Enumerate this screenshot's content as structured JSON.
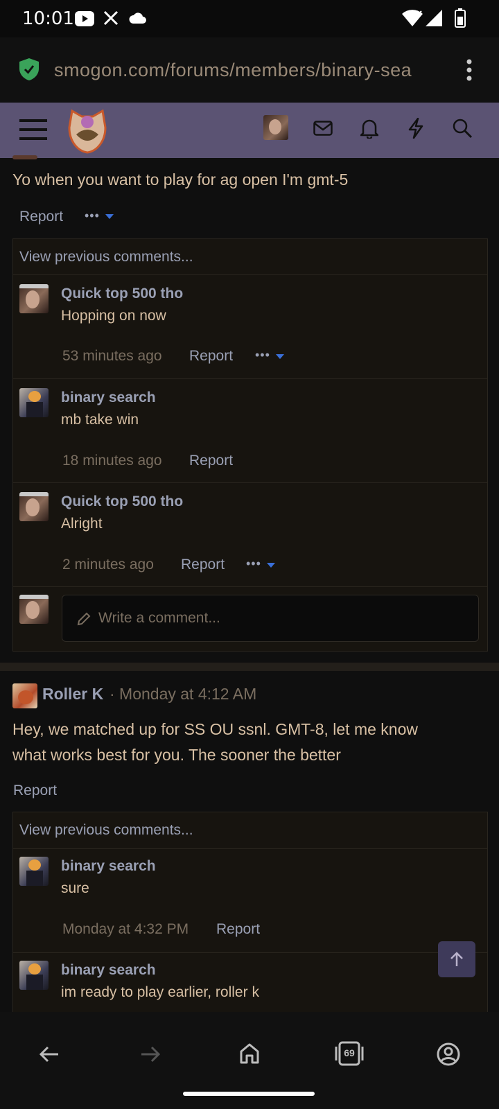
{
  "status_bar": {
    "time": "10:01"
  },
  "browser": {
    "url": "smogon.com/forums/members/binary-sea",
    "tabs_count": "69"
  },
  "post1": {
    "text": "Yo when you want to play for ag open I'm gmt-5",
    "report_label": "Report",
    "more_label": "•••",
    "comments": {
      "view_previous": "View previous comments...",
      "items": [
        {
          "user": "Quick top 500 tho",
          "text": "Hopping on now",
          "time": "53 minutes ago",
          "report": "Report",
          "more": "•••"
        },
        {
          "user": "binary search",
          "text": "mb take win",
          "time": "18 minutes ago",
          "report": "Report"
        },
        {
          "user": "Quick top 500 tho",
          "text": "Alright",
          "time": "2 minutes ago",
          "report": "Report",
          "more": "•••"
        }
      ],
      "write_placeholder": "Write a comment..."
    }
  },
  "post2": {
    "author": "Roller K",
    "meta": "· Monday at 4:12 AM",
    "text_line1": "Hey, we matched up for SS OU ssnl. GMT-8, let me know",
    "text_line2": "what works best for you. The sooner the better",
    "report_label": "Report",
    "comments": {
      "view_previous": "View previous comments...",
      "items": [
        {
          "user": "binary search",
          "text": "sure",
          "time": "Monday at 4:32 PM",
          "report": "Report"
        },
        {
          "user": "binary search",
          "text": "im ready to play earlier, roller k"
        }
      ]
    }
  }
}
